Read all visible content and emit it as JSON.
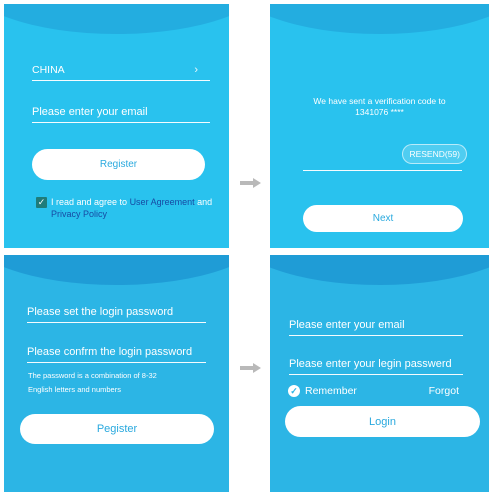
{
  "screen1": {
    "country_label": "CHINA",
    "email_placeholder": "Please enter your email",
    "register_label": "Register",
    "agree_prefix": "I read and agree to ",
    "user_agreement": "User Agreement",
    "agree_and": " and",
    "privacy_policy": "Privacy Policy"
  },
  "screen2": {
    "message_line1": "We have sent a verification code to",
    "message_line2": "1341076 ****",
    "resend_label": "RESEND(59)",
    "next_label": "Next"
  },
  "screen3": {
    "set_password_placeholder": "Please set the login password",
    "confirm_password_placeholder": "Please confrm the login password",
    "note_line1": "The password is a combination of 8-32",
    "note_line2": "English letters and numbers",
    "register_label": "Pegister"
  },
  "screen4": {
    "email_placeholder": "Please enter your email",
    "password_placeholder": "Please enter your legin passwerd",
    "remember_label": "Remember",
    "forgot_label": "Forgot",
    "login_label": "Login"
  },
  "icons": [
    "chevron-right-icon",
    "checkbox-icon",
    "checkmark-circle-icon",
    "right-arrow-icon"
  ],
  "colors": {
    "panel_light": "#29c2ee",
    "panel_dark": "#2cb5e5",
    "button_text": "#29a9de",
    "link": "#174aa3",
    "arrow": "#b9b9b9"
  }
}
